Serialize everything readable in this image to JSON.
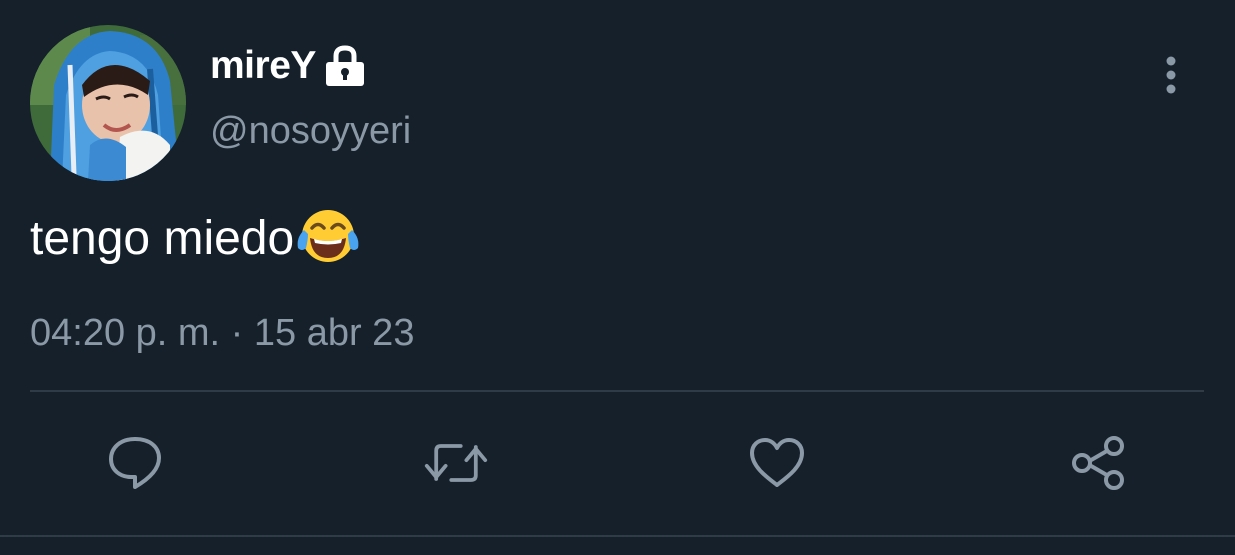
{
  "tweet": {
    "display_name": "mireY",
    "handle": "@nosoyyeri",
    "text": "tengo miedo",
    "emoji": "face-with-tears-of-joy",
    "timestamp": "04:20 p. m. · 15 abr 23",
    "locked": true
  },
  "icons": {
    "lock": "lock-icon",
    "more": "more-vertical-icon",
    "reply": "reply-icon",
    "retweet": "retweet-icon",
    "like": "heart-icon",
    "share": "share-icon"
  },
  "colors": {
    "background": "#15202b",
    "primary_text": "#ffffff",
    "secondary_text": "#8b98a5",
    "divider": "#2f3b47"
  }
}
